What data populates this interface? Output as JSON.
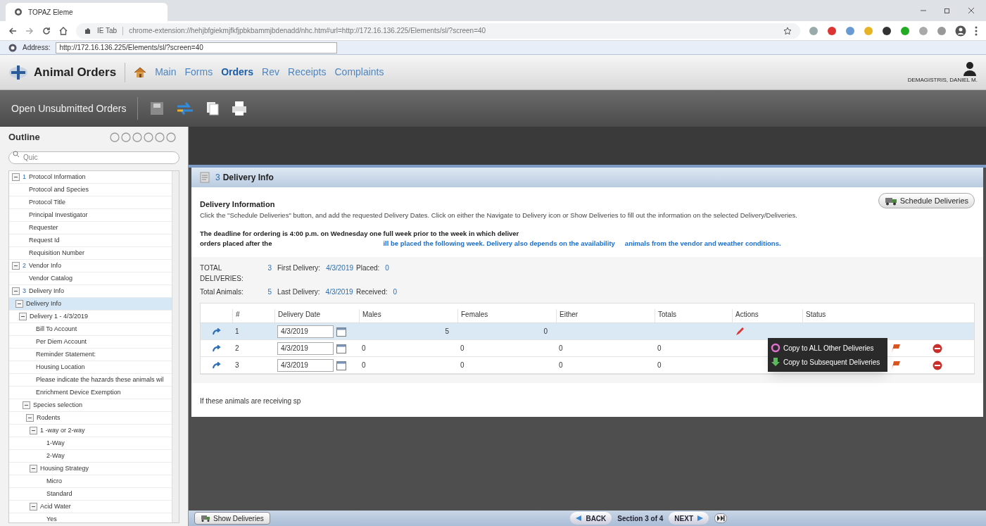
{
  "browser": {
    "tab_title": "TOPAZ Eleme",
    "extension_label": "IE Tab",
    "url": "chrome-extension://hehjbfgiekmjfkfjpbkbammjbdenadd/nhc.htm#url=http://172.16.136.225/Elements/sl/?screen=40",
    "ie_address_label": "Address:",
    "ie_address": "http://172.16.136.225/Elements/sl/?screen=40"
  },
  "app": {
    "title": "Animal Orders",
    "user": "DEMAGISTRIS, DANIEL M.",
    "nav": [
      {
        "label": "Main",
        "selected": false
      },
      {
        "label": "Forms",
        "selected": false
      },
      {
        "label": "Orders",
        "selected": true
      },
      {
        "label": "Rev",
        "selected": false
      },
      {
        "label": "Receipts",
        "selected": false
      },
      {
        "label": "Complaints",
        "selected": false
      }
    ]
  },
  "toolbar": {
    "title": "Open Unsubmitted Orders"
  },
  "outline": {
    "title": "Outline",
    "search_placeholder": "Quic",
    "items": [
      {
        "number": "1",
        "label": "Protocol Information",
        "selected": false,
        "expanded": true,
        "children": [
          {
            "label": "Protocol and Species",
            "selected": false
          },
          {
            "label": "Protocol Title",
            "selected": false
          },
          {
            "label": "Principal Investigator",
            "selected": false
          },
          {
            "label": "Requester",
            "selected": false
          },
          {
            "label": "Request Id",
            "selected": false
          },
          {
            "label": "Requisition Number",
            "selected": false
          }
        ]
      },
      {
        "number": "2",
        "label": "Vendor Info",
        "selected": false,
        "expanded": true,
        "children": [
          {
            "label": "Vendor Catalog",
            "selected": false
          }
        ]
      },
      {
        "number": "3",
        "label": "Delivery Info",
        "selected": false,
        "expanded": true,
        "children": [
          {
            "label": "Delivery Info",
            "selected": true,
            "expanded": true,
            "children": [
              {
                "label": "Delivery 1 - 4/3/2019",
                "selected": false,
                "expanded": true,
                "children": [
                  {
                    "label": "Bill To Account",
                    "selected": false
                  },
                  {
                    "label": "Per Diem Account",
                    "selected": false
                  },
                  {
                    "label": "Reminder Statement:",
                    "selected": false
                  },
                  {
                    "label": "Housing Location",
                    "selected": false
                  },
                  {
                    "label": "Please indicate the hazards these animals wil",
                    "selected": false
                  },
                  {
                    "label": "Enrichment Device Exemption",
                    "selected": false
                  },
                  {
                    "label": "Species selection",
                    "selected": false,
                    "expanded": true,
                    "children": [
                      {
                        "label": "Rodents",
                        "selected": false,
                        "expanded": true,
                        "children": [
                          {
                            "label": "1 -way or 2-way",
                            "selected": false,
                            "expanded": true,
                            "children": [
                              {
                                "label": "1-Way",
                                "selected": false
                              },
                              {
                                "label": "2-Way",
                                "selected": false
                              }
                            ]
                          },
                          {
                            "label": "Housing Strategy",
                            "selected": false,
                            "expanded": true,
                            "children": [
                              {
                                "label": "Micro",
                                "selected": false
                              },
                              {
                                "label": "Standard",
                                "selected": false
                              }
                            ]
                          },
                          {
                            "label": "Acid Water",
                            "selected": false,
                            "expanded": true,
                            "children": [
                              {
                                "label": "Yes",
                                "selected": false
                              }
                            ]
                          }
                        ]
                      }
                    ]
                  }
                ]
              }
            ]
          }
        ]
      }
    ]
  },
  "section": {
    "number": "3",
    "title": "Delivery Info",
    "heading": "Delivery Information",
    "schedule_button": "Schedule Deliveries",
    "instructions": "Click the \"Schedule Deliveries\" button, and add the requested Delivery Dates. Click on either the Navigate to Delivery icon or Show Deliveries to fill out the information on the selected Delivery/Deliveries.",
    "notice_line_1": "The deadline for ordering is 4:00 p.m. on Wednesday one full week prior to the week in which deliver",
    "notice_line_2_start": "orders placed after the",
    "notice_line_2_middle": "ill be placed the following week. Delivery also depends on the availability",
    "notice_line_2_end": "animals from the vendor and weather conditions.",
    "summary": [
      [
        {
          "label": "TOTAL DELIVERIES:",
          "value": "3"
        },
        {
          "label": "First Delivery:",
          "value": "4/3/2019"
        },
        {
          "label": "Placed:",
          "value": "0"
        }
      ],
      [
        {
          "label": "Total Animals:",
          "value": "5"
        },
        {
          "label": "Last Delivery:",
          "value": "4/3/2019"
        },
        {
          "label": "Received:",
          "value": "0"
        }
      ]
    ],
    "table": {
      "columns": [
        "#",
        "Delivery Date",
        "Males",
        "Females",
        "Either",
        "Totals",
        "Actions",
        "Status"
      ],
      "rows": [
        {
          "cells": [
            "1",
            "4/3/2019",
            "5",
            "0"
          ],
          "selected": true,
          "flag": false
        },
        {
          "cells": [
            "2",
            "4/3/2019",
            "0",
            "0",
            "0",
            "0"
          ],
          "selected": false,
          "flag": true
        },
        {
          "cells": [
            "3",
            "4/3/2019",
            "0",
            "0",
            "0",
            "0"
          ],
          "selected": false,
          "flag": true
        }
      ]
    },
    "menu": [
      "Copy to ALL Other Deliveries",
      "Copy to Subsequent Deliveries"
    ],
    "footnote": "If these animals are receiving sp"
  },
  "footer": {
    "show_deliveries": "Show Deliveries",
    "back": "BACK",
    "section_label": "Section 3 of 4",
    "next": "NEXT"
  }
}
